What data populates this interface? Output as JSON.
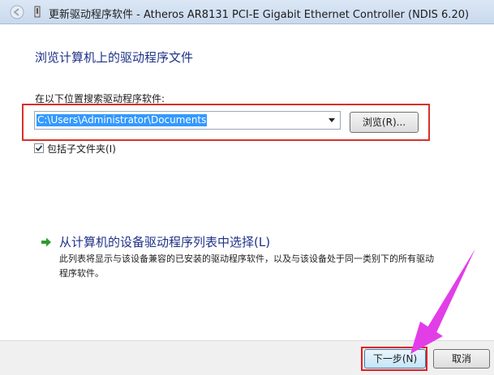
{
  "window": {
    "title": "更新驱动程序软件 - Atheros AR8131 PCI-E Gigabit Ethernet Controller (NDIS 6.20)"
  },
  "main": {
    "heading": "浏览计算机上的驱动程序文件",
    "search_label": "在以下位置搜索驱动程序软件:",
    "path_value": "C:\\Users\\Administrator\\Documents",
    "browse_label": "浏览(R)...",
    "include_subfolders_label": "包括子文件夹(I)",
    "include_subfolders_checked": true,
    "pick_link_title": "从计算机的设备驱动程序列表中选择(L)",
    "pick_link_description": "此列表将显示与该设备兼容的已安装的驱动程序软件，以及与该设备处于同一类别下的所有驱动程序软件。"
  },
  "footer": {
    "next_label": "下一步(N)",
    "cancel_label": "取消"
  },
  "colors": {
    "accent_heading": "#1e3287",
    "highlight_red": "#d9302b",
    "selection_blue": "#3399ff",
    "annotation_arrow": "#e23ee8",
    "link_arrow_green": "#2e9a2e"
  }
}
